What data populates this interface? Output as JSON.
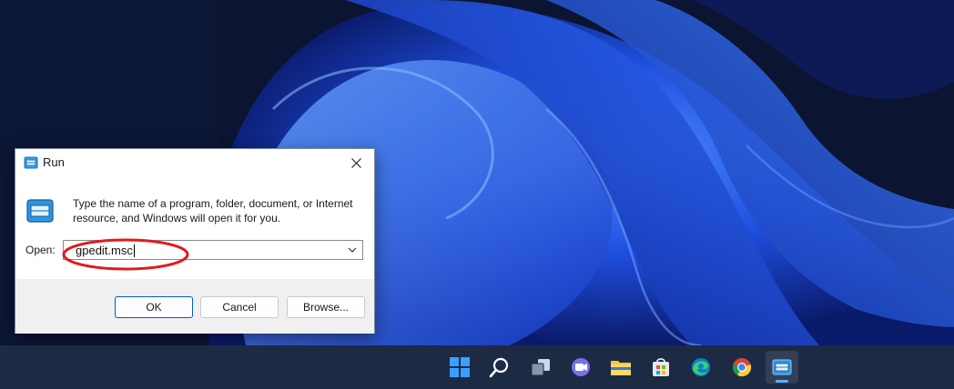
{
  "colors": {
    "wallpaper_dark": "#0b1430",
    "wallpaper_blue": "#1f4fe0",
    "accent": "#005fb8",
    "highlight_ellipse": "#e11b1b",
    "taskbar": "#1d2a44"
  },
  "dialog": {
    "title": "Run",
    "icon": "run-icon",
    "close_icon": "close-icon",
    "description": "Type the name of a program, folder, document, or Internet resource, and Windows will open it for you.",
    "open_label": "Open:",
    "open_value": "gpedit.msc",
    "dropdown_icon": "chevron-down-icon",
    "buttons": {
      "ok": "OK",
      "cancel": "Cancel",
      "browse": "Browse..."
    }
  },
  "taskbar": {
    "apps": [
      {
        "icon": "windows-start-icon"
      },
      {
        "icon": "search-icon"
      },
      {
        "icon": "task-view-icon"
      },
      {
        "icon": "teams-chat-icon"
      },
      {
        "icon": "file-explorer-icon"
      },
      {
        "icon": "microsoft-store-icon"
      },
      {
        "icon": "edge-icon"
      },
      {
        "icon": "chrome-icon"
      },
      {
        "icon": "run-icon",
        "active": true
      }
    ]
  }
}
